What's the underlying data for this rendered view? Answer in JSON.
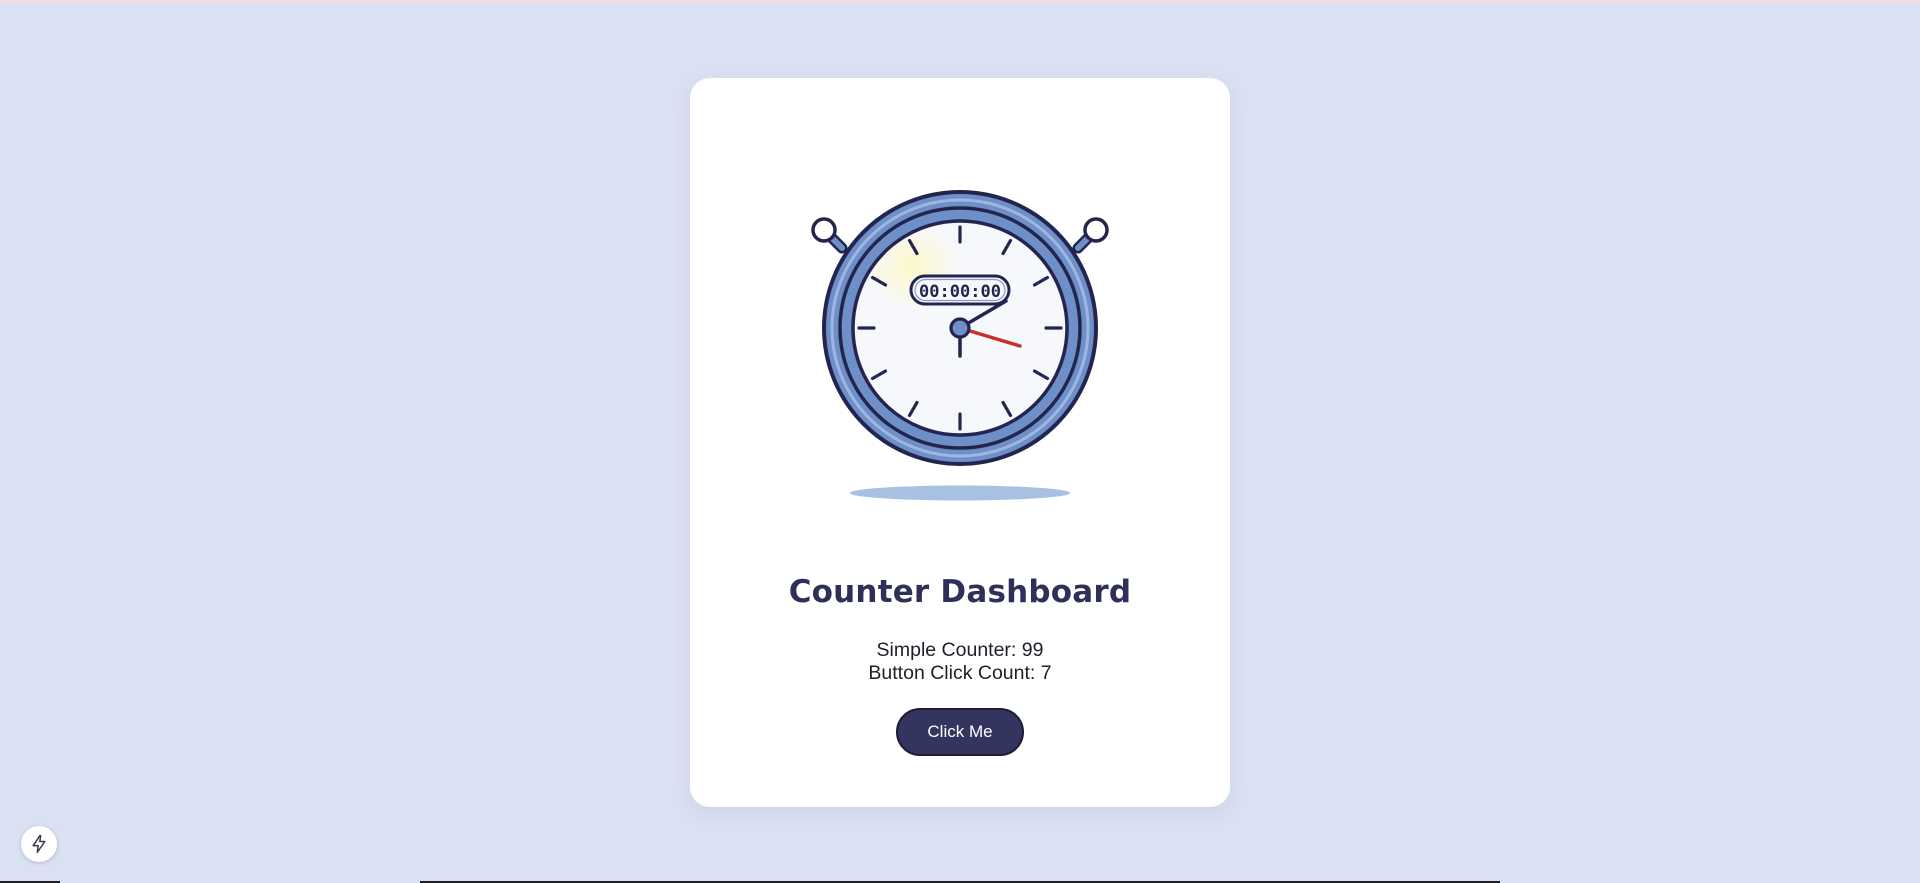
{
  "card": {
    "title": "Counter Dashboard",
    "simple_counter": "Simple Counter: 99",
    "button_click_count": "Button Click Count: 7",
    "button_label": "Click Me"
  },
  "stopwatch": {
    "display": "00:00:00",
    "icon": "stopwatch-illustration"
  },
  "badge": {
    "icon": "lightning-bolt-icon"
  },
  "colors": {
    "background": "#d9e1f2",
    "card": "#ffffff",
    "title": "#2f3059",
    "button": "#33355e",
    "watch_body": "#6f8fc8",
    "watch_outline": "#23254f",
    "second_hand": "#c9302c"
  }
}
